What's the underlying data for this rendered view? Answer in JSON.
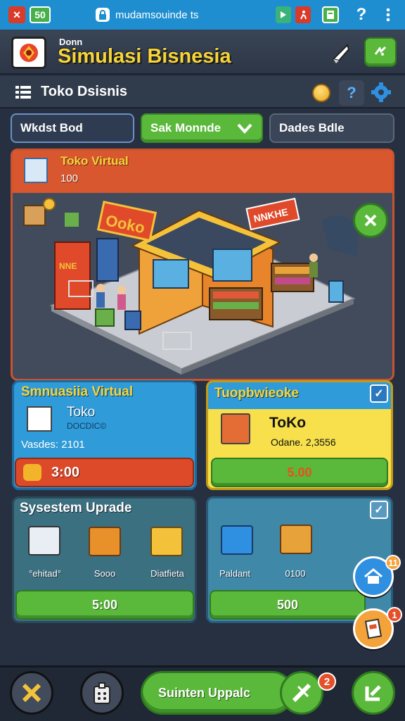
{
  "statusbar": {
    "left_badge_1": "✕",
    "left_badge_2": "50",
    "url": "mudamsouinde ts",
    "help": "?"
  },
  "header": {
    "small_title": "Donn",
    "title": "Simulasi Bisnesia"
  },
  "subheader": {
    "store_title": "Toko Dsisnis",
    "help": "?"
  },
  "tabs": [
    {
      "label": "Wkdst Bod"
    },
    {
      "label": "Sak Monnde"
    },
    {
      "label": "Dades Bdle"
    }
  ],
  "hero": {
    "title": "Toko Virtual",
    "value": "100",
    "sign_main": "Ooko",
    "sign_roof": "NNKHE",
    "sign_side": "NNE"
  },
  "card_left": {
    "title": "Smnuasiia Virtual",
    "name": "Toko",
    "sub": "DOCDIC©",
    "value": "Vasdes: 2101",
    "price": "3:00"
  },
  "card_right": {
    "title": "Tuopbwieoke",
    "name": "ToKo",
    "sub": "Odane. 2,3556",
    "price": "5.00"
  },
  "upgrade_left": {
    "title": "Sysestem Uprade",
    "items": [
      {
        "label": "°ehitad°"
      },
      {
        "label": "Sooo"
      },
      {
        "label": "Diatfieta"
      }
    ],
    "price": "5:00"
  },
  "upgrade_right": {
    "items": [
      {
        "label": "Paldant"
      },
      {
        "label": "0100"
      }
    ],
    "price": "500"
  },
  "floating": {
    "badge_top": "11",
    "badge_bottom": "1"
  },
  "bottom_nav": {
    "main_label": "Suinten Uppalc",
    "badge": "2"
  },
  "colors": {
    "accent_green": "#5ab93a",
    "accent_red": "#dc4a2a",
    "accent_blue": "#2f9bd8",
    "accent_yellow": "#f7e04c",
    "title_yellow": "#f6d53b"
  }
}
